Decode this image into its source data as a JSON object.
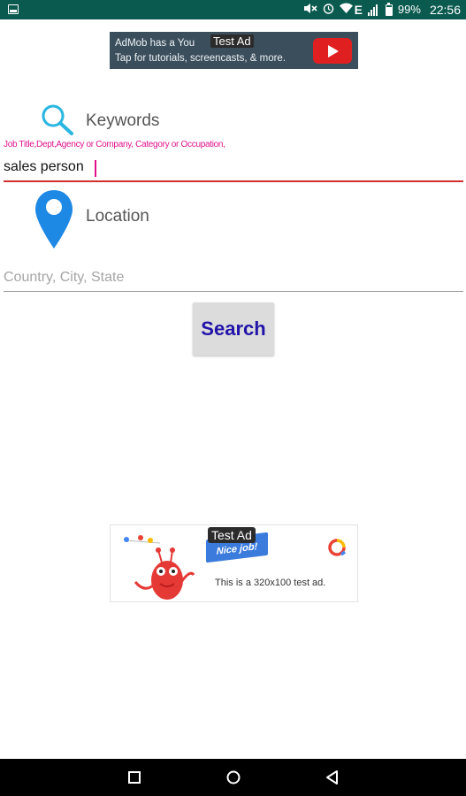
{
  "status_bar": {
    "battery": "99%",
    "network": "E",
    "time": "22:56",
    "icons": [
      "screenshot-icon",
      "mute-icon",
      "alarm-icon",
      "wifi-icon",
      "signal-icon",
      "battery-icon"
    ]
  },
  "top_ad": {
    "line1": "AdMob has a You",
    "line1_end": "!",
    "line2": "Tap for tutorials, screencasts, & more.",
    "test_label": "Test Ad",
    "icon": "youtube-play-icon",
    "bg_color": "#3b4e5c"
  },
  "keywords": {
    "icon": "search-icon",
    "title": "Keywords",
    "hint": "Job Title,Dept,Agency or Company, Category or Occupation,",
    "value": "sales person",
    "accent": "#d32f2f",
    "hint_color": "#e0118b"
  },
  "location": {
    "icon": "location-pin-icon",
    "title": "Location",
    "placeholder": "Country, City, State",
    "value": ""
  },
  "search_button": {
    "label": "Search",
    "text_color": "#2214a8"
  },
  "bottom_ad": {
    "test_label": "Test Ad",
    "flag_text": "Nice job!",
    "text": "This is a 320x100 test ad."
  },
  "nav_bar": {
    "buttons": [
      "recents-square-icon",
      "home-circle-icon",
      "back-triangle-icon"
    ]
  }
}
